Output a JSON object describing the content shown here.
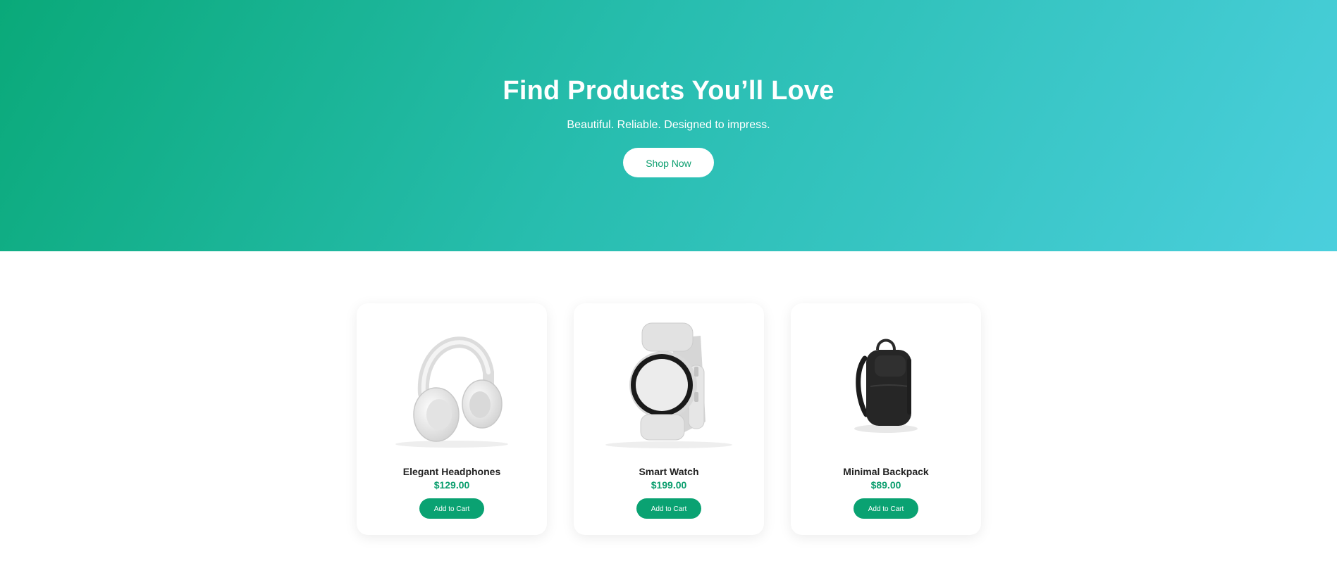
{
  "hero": {
    "title": "Find Products You’ll Love",
    "subtitle": "Beautiful. Reliable. Designed to impress.",
    "cta_label": "Shop Now",
    "gradient_start": "#0aa979",
    "gradient_end": "#4bcfdd"
  },
  "products": [
    {
      "name": "Elegant Headphones",
      "price": "$129.00",
      "button_label": "Add to Cart",
      "image_icon": "headphones"
    },
    {
      "name": "Smart Watch",
      "price": "$199.00",
      "button_label": "Add to Cart",
      "image_icon": "smartwatch"
    },
    {
      "name": "Minimal Backpack",
      "price": "$89.00",
      "button_label": "Add to Cart",
      "image_icon": "backpack"
    }
  ],
  "colors": {
    "accent": "#0aa272",
    "price": "#0b9e6e",
    "text": "#222222"
  }
}
